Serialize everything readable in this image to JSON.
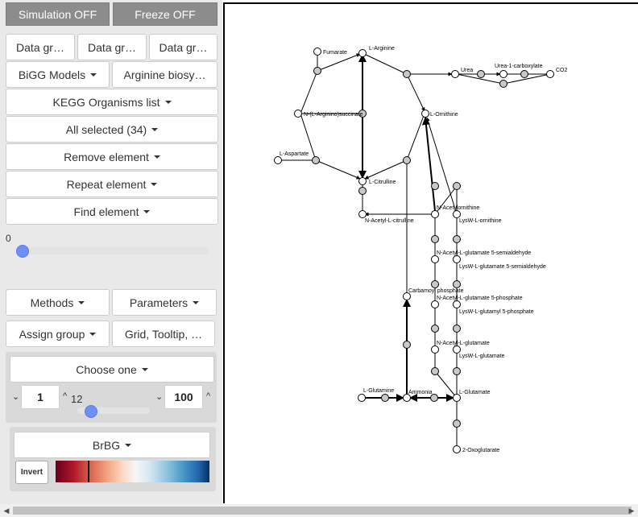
{
  "toolbar": {
    "simulation": "Simulation OFF",
    "freeze": "Freeze OFF",
    "data_group_1": "Data gr…",
    "data_group_2": "Data gr…",
    "data_group_3": "Data gr…",
    "bigg_models": "BiGG Models",
    "pathway": "Arginine biosy…",
    "kegg": "KEGG Organisms list",
    "all_selected": "All selected (34)",
    "remove": "Remove element",
    "repeat": "Repeat element",
    "find": "Find element",
    "slider_value": "0",
    "slider_fraction": 0
  },
  "controls": {
    "methods": "Methods",
    "parameters": "Parameters",
    "assign_group": "Assign group",
    "grid": "Grid, Tooltip, …",
    "choose": "Choose one",
    "min_value": "1",
    "mid_value": "12",
    "max_value": "100",
    "mid_fraction": 0.12,
    "colormap": "BrBG",
    "invert": "Invert",
    "colormap_marker_fraction": 0.21,
    "colors": {
      "node_active": "#c8c8c8",
      "knob": "#6f8ff2",
      "panel": "#e9e9e9",
      "dark_button": "#8c8c8c"
    }
  },
  "network": {
    "labels": {
      "fumarate": "Fumarate",
      "arginine": "L-Arginine",
      "urea": "Urea",
      "urea1c": "Urea-1-carboxylate",
      "co2": "CO2",
      "succinate": "N-(L-Arginino)succinate",
      "ornithine": "L-Ornithine",
      "aspartate": "L-Aspartate",
      "citrulline": "L-Citrulline",
      "acetylcit": "N-Acetyl-L-citrulline",
      "acetylorn": "N-Acetylornithine",
      "lysworn": "LysW-L-ornithine",
      "acetylglusemi": "N-Acetyl-L-glutamate 5-semialdehyde",
      "lyswsemi": "LysW-L-glutamate 5-semialdehyde",
      "carbamoyl": "Carbamoyl phosphate",
      "acetylglup": "N-Acetyl-L-glutamate 5-phosphate",
      "lyswp": "LysW-L-glutamyl 5-phosphate",
      "acetylglu": "N-Acetyl-L-glutamate",
      "lyswglu": "LysW-L-glutamate",
      "glutamine": "L-Glutamine",
      "ammonia": "Ammonia",
      "glutamate": "L-Glutamate",
      "oxoglutarate": "2-Oxoglutarate"
    }
  }
}
